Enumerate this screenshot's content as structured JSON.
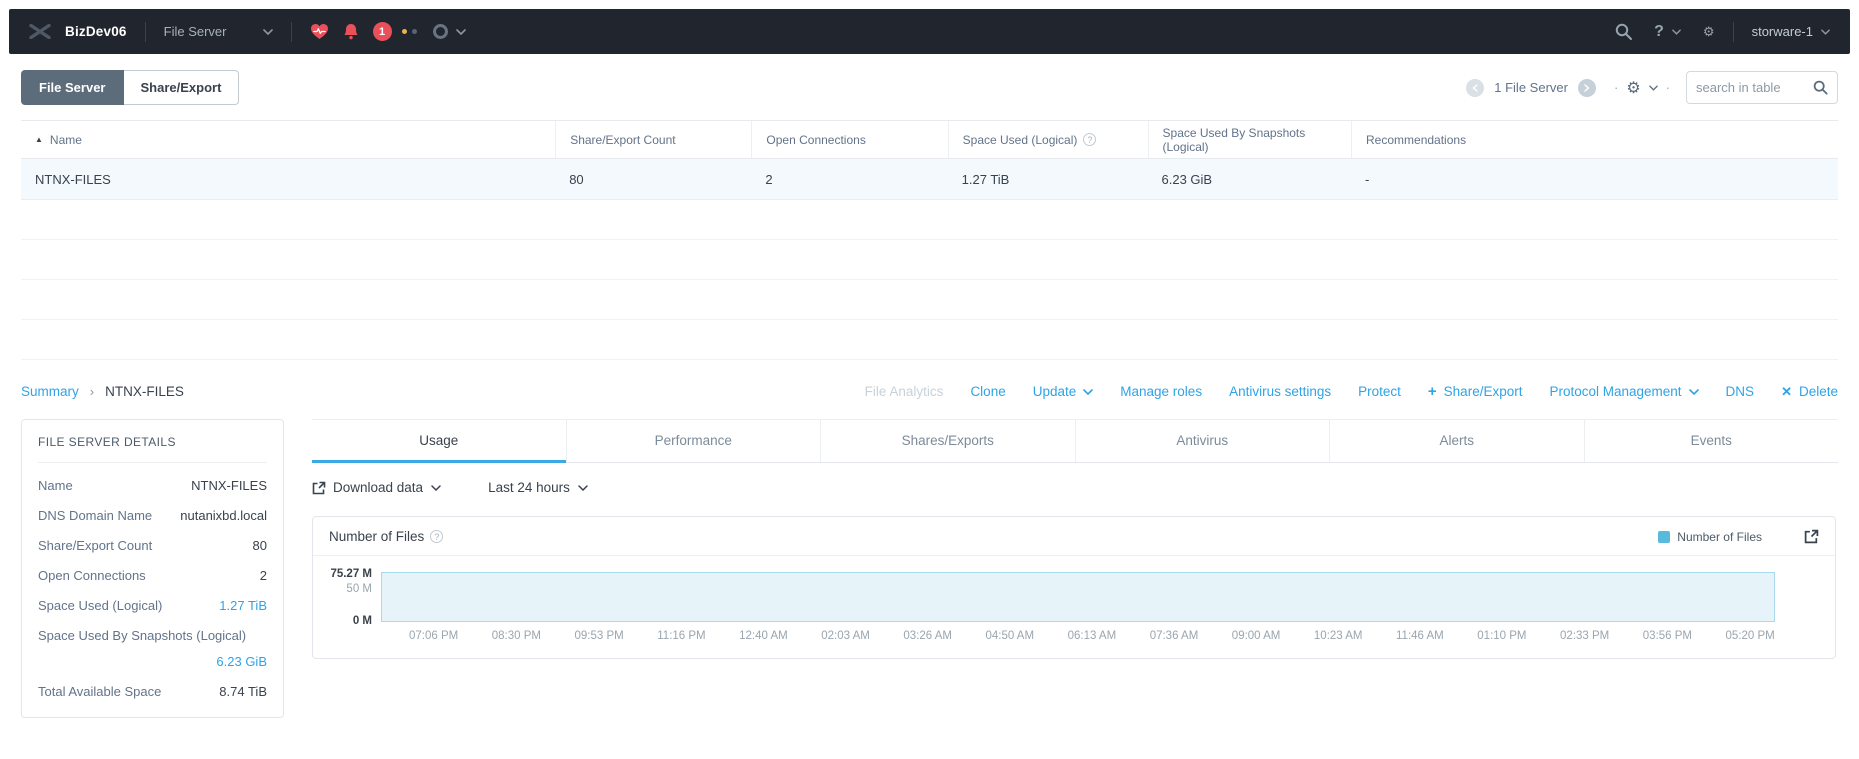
{
  "navbar": {
    "brand": "BizDev06",
    "context_selector": "File Server",
    "alert_badge_count": "1",
    "help_label": "?",
    "user": "storware-1"
  },
  "view_toggle": {
    "active_tab": "File Server",
    "inactive_tab": "Share/Export"
  },
  "table_controls": {
    "count_label": "1 File Server",
    "separator": "·",
    "search_placeholder": "search in table"
  },
  "table": {
    "columns": {
      "0": "Name",
      "1": "Share/Export Count",
      "2": "Open Connections",
      "3": "Space Used (Logical)",
      "4": "Space Used By Snapshots (Logical)",
      "5": "Recommendations"
    },
    "row": {
      "name": "NTNX-FILES",
      "share_export_count": "80",
      "open_connections": "2",
      "space_used_logical": "1.27 TiB",
      "space_used_snapshots": "6.23 GiB",
      "recommendations": "-"
    }
  },
  "breadcrumb": {
    "parent": "Summary",
    "separator": "›",
    "current": "NTNX-FILES"
  },
  "actions": {
    "file_analytics": "File Analytics",
    "clone": "Clone",
    "update": "Update",
    "manage_roles": "Manage roles",
    "antivirus_settings": "Antivirus settings",
    "protect": "Protect",
    "share_export_plus": "+",
    "share_export": "Share/Export",
    "protocol_management": "Protocol Management",
    "dns": "DNS",
    "delete_x": "✕",
    "delete": "Delete"
  },
  "details": {
    "title": "FILE SERVER DETAILS",
    "rows": {
      "0": {
        "label": "Name",
        "value": "NTNX-FILES"
      },
      "1": {
        "label": "DNS Domain Name",
        "value": "nutanixbd.local"
      },
      "2": {
        "label": "Share/Export Count",
        "value": "80"
      },
      "3": {
        "label": "Open Connections",
        "value": "2"
      },
      "4": {
        "label": "Space Used (Logical)",
        "value": "1.27 TiB"
      },
      "5": {
        "label": "Space Used By Snapshots (Logical)",
        "value": "6.23 GiB"
      },
      "6": {
        "label": "Total Available Space",
        "value": "8.74 TiB"
      }
    }
  },
  "detail_tabs": {
    "0": "Usage",
    "1": "Performance",
    "2": "Shares/Exports",
    "3": "Antivirus",
    "4": "Alerts",
    "5": "Events"
  },
  "chart_toolbar": {
    "download_label": "Download data",
    "range_label": "Last 24 hours"
  },
  "chart": {
    "title": "Number of Files",
    "legend_label": "Number of Files",
    "legend_color": "#58badd"
  },
  "chart_data": {
    "type": "area",
    "title": "Number of Files",
    "series": [
      {
        "name": "Number of Files",
        "values_millions": [
          75.27,
          75.27,
          75.27,
          75.27,
          75.27,
          75.27,
          75.27,
          75.27,
          75.27,
          75.27,
          75.27,
          75.27,
          75.27,
          75.27,
          75.27,
          75.27,
          75.27
        ]
      }
    ],
    "x_ticks": {
      "0": "07:06 PM",
      "1": "08:30 PM",
      "2": "09:53 PM",
      "3": "11:16 PM",
      "4": "12:40 AM",
      "5": "02:03 AM",
      "6": "03:26 AM",
      "7": "04:50 AM",
      "8": "06:13 AM",
      "9": "07:36 AM",
      "10": "09:00 AM",
      "11": "10:23 AM",
      "12": "11:46 AM",
      "13": "01:10 PM",
      "14": "02:33 PM",
      "15": "03:56 PM",
      "16": "05:20 PM"
    },
    "y_ticks": {
      "0": "75.27 M",
      "1": "50 M",
      "2": "0 M"
    },
    "ylim_millions": [
      0,
      75.27
    ],
    "time_range": "Last 24 hours",
    "legend_position": "top-right",
    "grid": false,
    "fill_color": "#e6f4fa",
    "line_color": "#a9d9eb"
  }
}
